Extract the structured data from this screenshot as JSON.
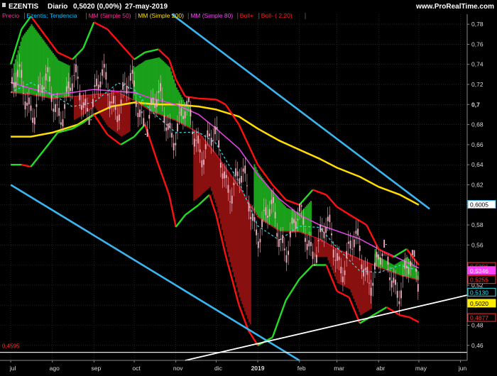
{
  "header": {
    "symbol": "EZENTIS",
    "period": "Diario",
    "quote": "0,5020 (0,00%)",
    "date": "27-may-2019",
    "site": "www.ProRealTime.com"
  },
  "legend": [
    {
      "label": "Precio",
      "color": "#ff2aa0"
    },
    {
      "label": "Ezentis: Tendencia",
      "color": "#00c0ff"
    },
    {
      "label": "MM (Simple 50)",
      "color": "#ff2aa0"
    },
    {
      "label": "MM (Simple 200)",
      "color": "#ffe000"
    },
    {
      "label": "MM (Simple 80)",
      "color": "#ff40ff"
    },
    {
      "label": "Boll+",
      "color": "#ff2020"
    },
    {
      "label": "Boll- ( 2.20)",
      "color": "#ff2020"
    }
  ],
  "colors": {
    "background": "#000000",
    "grid": "#3a3a3a",
    "channel": "#39b6f0",
    "support": "#ffffff",
    "ma200": "#ffdd00",
    "ma80": "#e040e0",
    "ma50": "#d01020",
    "boll_upper_bull": "#22dd22",
    "boll_upper_bear": "#ff1010",
    "boll_lower": "#22dd22",
    "cloud_bull": "#1aa01a",
    "cloud_bear": "#8a1010",
    "dashed_band": "#30e0f0",
    "candle": "#f0b0c0"
  },
  "chart_data": {
    "type": "candlestick",
    "symbol": "EZENTIS",
    "timeframe": "Diario",
    "ylim": [
      0.445,
      0.79
    ],
    "y_ticks": [
      "0,46",
      "0,48",
      "0,5",
      "0,52",
      "0,54",
      "0,56",
      "0,58",
      "0,6",
      "0,62",
      "0,64",
      "0,66",
      "0,68",
      "0,7",
      "0,72",
      "0,74",
      "0,76",
      "0,78"
    ],
    "y_tick_values": [
      0.46,
      0.48,
      0.5,
      0.52,
      0.54,
      0.56,
      0.58,
      0.6,
      0.62,
      0.64,
      0.66,
      0.68,
      0.7,
      0.72,
      0.74,
      0.76,
      0.78
    ],
    "x_labels": [
      "jul",
      "ago",
      "sep",
      "oct",
      "nov",
      "dic",
      "2019",
      "feb",
      "mar",
      "abr",
      "may",
      "jun"
    ],
    "x_label_days": [
      0,
      31,
      62,
      92,
      123,
      153,
      184,
      215,
      243,
      274,
      304,
      335
    ],
    "total_days": 340,
    "price_labels": [
      {
        "text": "0,6005",
        "value": 0.6005,
        "bg": "#ffffff",
        "fg": "#000000",
        "border": "#39b6f0"
      },
      {
        "text": "0,5386",
        "value": 0.5386,
        "bg": "#000000",
        "fg": "#ff3030",
        "border": "#ff3030"
      },
      {
        "text": "0,5346",
        "value": 0.5346,
        "bg": "#ff40ff",
        "fg": "#ffffff",
        "border": "#ff40ff"
      },
      {
        "text": "0,5255",
        "value": 0.5255,
        "bg": "#000000",
        "fg": "#ff3030",
        "border": "#ff3030"
      },
      {
        "text": "0,5130",
        "value": 0.513,
        "bg": "#000000",
        "fg": "#30e0f0",
        "border": "#30e0f0"
      },
      {
        "text": "0,5020",
        "value": 0.502,
        "bg": "#ffee00",
        "fg": "#000000",
        "border": "#ffee00"
      },
      {
        "text": "0,4877",
        "value": 0.4877,
        "bg": "#000000",
        "fg": "#ff3030",
        "border": "#ff3030"
      }
    ],
    "low_annotation": "0,4595",
    "trend_channel_upper": [
      [
        120,
        0.79
      ],
      [
        312,
        0.596
      ]
    ],
    "trend_channel_lower": [
      [
        0,
        0.62
      ],
      [
        215,
        0.445
      ]
    ],
    "support_line": [
      [
        130,
        0.445
      ],
      [
        340,
        0.51
      ]
    ],
    "hline": 0.453,
    "ma200": [
      [
        0,
        0.668
      ],
      [
        15,
        0.668
      ],
      [
        31,
        0.672
      ],
      [
        50,
        0.68
      ],
      [
        62,
        0.69
      ],
      [
        75,
        0.698
      ],
      [
        92,
        0.702
      ],
      [
        110,
        0.7
      ],
      [
        123,
        0.7
      ],
      [
        140,
        0.698
      ],
      [
        153,
        0.695
      ],
      [
        170,
        0.688
      ],
      [
        184,
        0.676
      ],
      [
        200,
        0.664
      ],
      [
        215,
        0.655
      ],
      [
        230,
        0.646
      ],
      [
        243,
        0.637
      ],
      [
        260,
        0.628
      ],
      [
        274,
        0.618
      ],
      [
        290,
        0.61
      ],
      [
        304,
        0.6
      ]
    ],
    "ma80": [
      [
        0,
        0.722
      ],
      [
        15,
        0.716
      ],
      [
        31,
        0.71
      ],
      [
        46,
        0.712
      ],
      [
        62,
        0.715
      ],
      [
        80,
        0.713
      ],
      [
        92,
        0.712
      ],
      [
        105,
        0.706
      ],
      [
        123,
        0.7
      ],
      [
        140,
        0.69
      ],
      [
        153,
        0.676
      ],
      [
        170,
        0.656
      ],
      [
        184,
        0.63
      ],
      [
        200,
        0.606
      ],
      [
        215,
        0.59
      ],
      [
        230,
        0.58
      ],
      [
        243,
        0.574
      ],
      [
        260,
        0.566
      ],
      [
        274,
        0.556
      ],
      [
        290,
        0.546
      ],
      [
        304,
        0.537
      ]
    ],
    "ma50": [
      [
        0,
        0.712
      ],
      [
        15,
        0.71
      ],
      [
        31,
        0.706
      ],
      [
        46,
        0.708
      ],
      [
        62,
        0.71
      ],
      [
        80,
        0.712
      ],
      [
        92,
        0.704
      ],
      [
        105,
        0.693
      ],
      [
        123,
        0.684
      ],
      [
        140,
        0.672
      ],
      [
        153,
        0.65
      ],
      [
        170,
        0.618
      ],
      [
        184,
        0.588
      ],
      [
        200,
        0.574
      ],
      [
        215,
        0.573
      ],
      [
        230,
        0.566
      ],
      [
        243,
        0.556
      ],
      [
        260,
        0.546
      ],
      [
        274,
        0.538
      ],
      [
        290,
        0.53
      ],
      [
        304,
        0.525
      ]
    ],
    "boll_upper": [
      [
        0,
        0.74
      ],
      [
        8,
        0.775
      ],
      [
        15,
        0.788
      ],
      [
        25,
        0.77
      ],
      [
        35,
        0.752
      ],
      [
        46,
        0.745
      ],
      [
        54,
        0.756
      ],
      [
        62,
        0.782
      ],
      [
        72,
        0.775
      ],
      [
        82,
        0.76
      ],
      [
        92,
        0.745
      ],
      [
        100,
        0.752
      ],
      [
        110,
        0.755
      ],
      [
        118,
        0.745
      ],
      [
        123,
        0.725
      ],
      [
        130,
        0.708
      ],
      [
        140,
        0.706
      ],
      [
        153,
        0.705
      ],
      [
        160,
        0.7
      ],
      [
        170,
        0.68
      ],
      [
        184,
        0.64
      ],
      [
        195,
        0.62
      ],
      [
        205,
        0.605
      ],
      [
        215,
        0.6
      ],
      [
        225,
        0.615
      ],
      [
        235,
        0.61
      ],
      [
        243,
        0.598
      ],
      [
        255,
        0.588
      ],
      [
        265,
        0.58
      ],
      [
        274,
        0.556
      ],
      [
        285,
        0.548
      ],
      [
        295,
        0.556
      ],
      [
        304,
        0.54
      ]
    ],
    "boll_lower": [
      [
        0,
        0.64
      ],
      [
        8,
        0.64
      ],
      [
        15,
        0.638
      ],
      [
        25,
        0.655
      ],
      [
        35,
        0.672
      ],
      [
        46,
        0.676
      ],
      [
        54,
        0.682
      ],
      [
        62,
        0.69
      ],
      [
        72,
        0.67
      ],
      [
        82,
        0.66
      ],
      [
        92,
        0.668
      ],
      [
        100,
        0.68
      ],
      [
        110,
        0.64
      ],
      [
        118,
        0.61
      ],
      [
        123,
        0.578
      ],
      [
        130,
        0.59
      ],
      [
        140,
        0.6
      ],
      [
        148,
        0.61
      ],
      [
        153,
        0.59
      ],
      [
        160,
        0.55
      ],
      [
        170,
        0.5
      ],
      [
        177,
        0.475
      ],
      [
        184,
        0.46
      ],
      [
        195,
        0.468
      ],
      [
        205,
        0.505
      ],
      [
        215,
        0.526
      ],
      [
        225,
        0.54
      ],
      [
        235,
        0.54
      ],
      [
        243,
        0.514
      ],
      [
        252,
        0.508
      ],
      [
        260,
        0.482
      ],
      [
        270,
        0.49
      ],
      [
        280,
        0.498
      ],
      [
        290,
        0.49
      ],
      [
        297,
        0.488
      ],
      [
        304,
        0.483
      ]
    ],
    "candles": []
  }
}
